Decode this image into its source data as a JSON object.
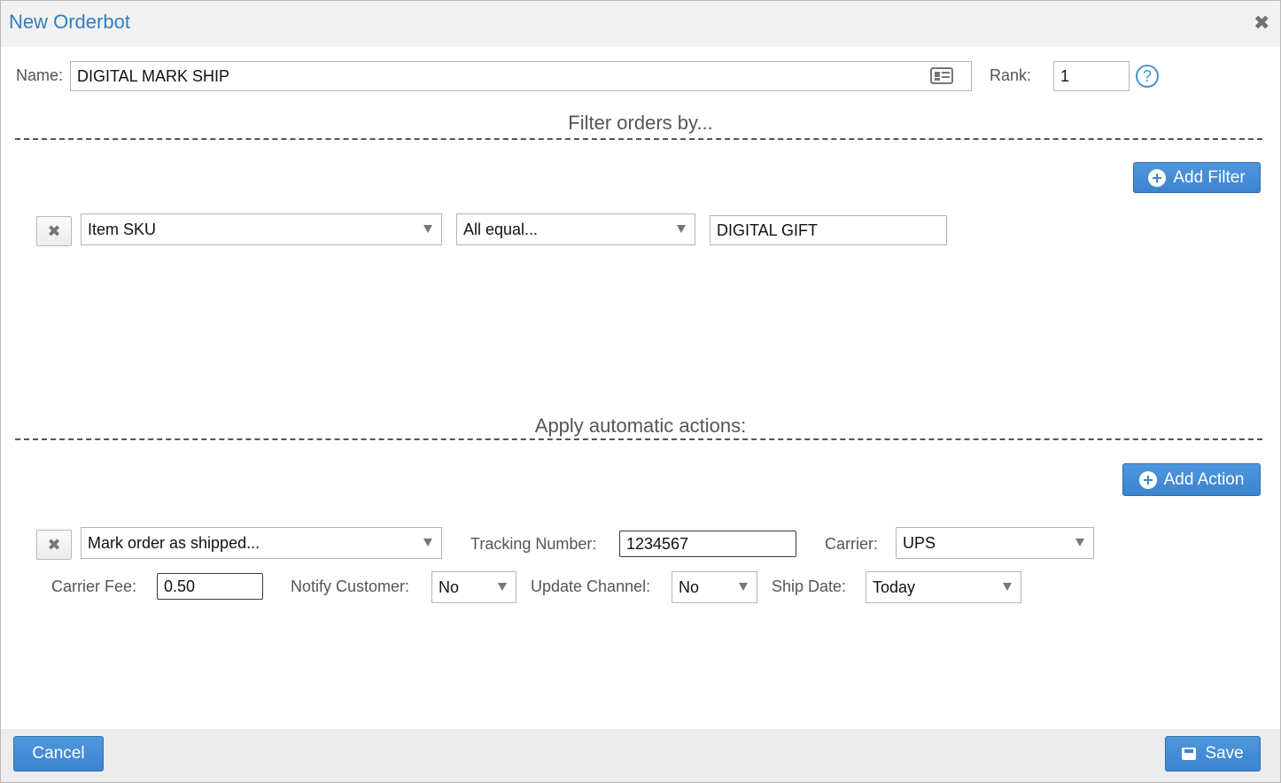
{
  "dialog": {
    "title": "New Orderbot"
  },
  "name_row": {
    "name_label": "Name:",
    "name_value": "DIGITAL MARK SHIP",
    "rank_label": "Rank:",
    "rank_value": "1",
    "help_glyph": "?"
  },
  "filters": {
    "section_title": "Filter orders by...",
    "add_label": "Add Filter",
    "rows": [
      {
        "field": "Item SKU",
        "operator": "All equal...",
        "value": "DIGITAL GIFT"
      }
    ]
  },
  "actions": {
    "section_title": "Apply automatic actions:",
    "add_label": "Add Action",
    "rows": [
      {
        "action": "Mark order as shipped...",
        "tracking_label": "Tracking Number:",
        "tracking_value": "1234567",
        "carrier_label": "Carrier:",
        "carrier_value": "UPS",
        "fee_label": "Carrier Fee:",
        "fee_value": "0.50",
        "notify_label": "Notify Customer:",
        "notify_value": "No",
        "update_label": "Update Channel:",
        "update_value": "No",
        "shipdate_label": "Ship Date:",
        "shipdate_value": "Today"
      }
    ]
  },
  "footer": {
    "cancel_label": "Cancel",
    "save_label": "Save"
  },
  "icons": {
    "close": "close-icon",
    "contact_card": "contact-card-icon",
    "help": "help-icon",
    "add": "plus-circle-icon",
    "remove": "remove-x-icon",
    "dropdown": "chevron-down-icon",
    "save": "save-icon"
  },
  "colors": {
    "accent": "#3b84cf",
    "title": "#2f7fc4",
    "footer_bg": "#ececec",
    "titlebar_bg": "#f2f2f2"
  }
}
